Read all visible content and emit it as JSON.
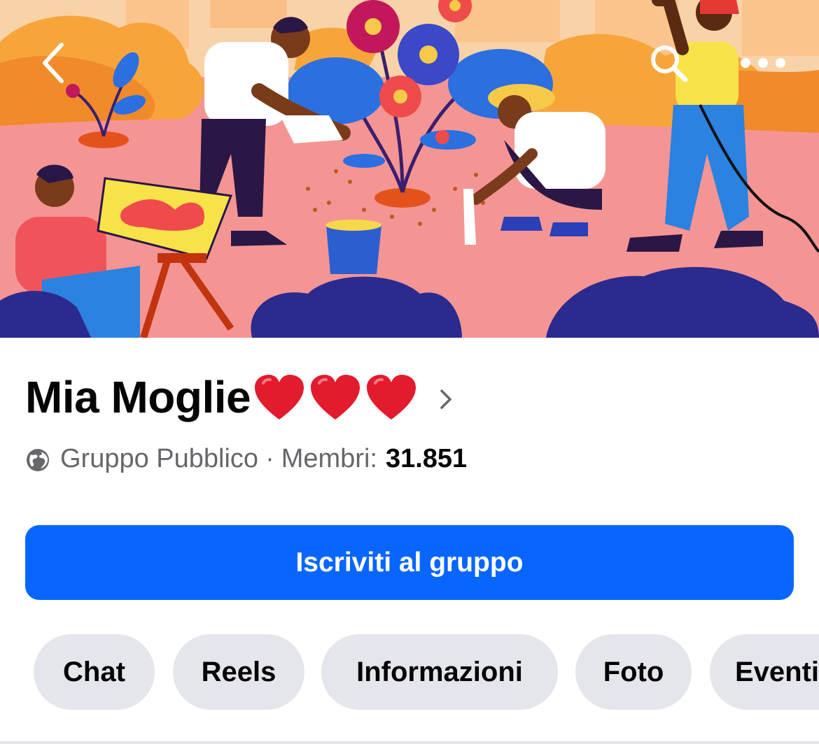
{
  "group": {
    "name": "Mia Moglie",
    "title_emoji": [
      "heart",
      "heart",
      "heart"
    ],
    "privacy": "Gruppo Pubblico",
    "separator": "·",
    "members_label": "Membri:",
    "members_count": "31.851"
  },
  "actions": {
    "join_label": "Iscriviti al gruppo"
  },
  "tabs": [
    {
      "label": "Chat"
    },
    {
      "label": "Reels"
    },
    {
      "label": "Informazioni"
    },
    {
      "label": "Foto"
    },
    {
      "label": "Eventi"
    }
  ],
  "icons": {
    "back": "chevron-left-icon",
    "search": "search-icon",
    "more": "more-dots-icon",
    "globe": "globe-icon",
    "title_chevron": "chevron-right-icon"
  },
  "colors": {
    "accent": "#0866ff",
    "chip": "#e4e6eb",
    "text_primary": "#050505",
    "text_secondary": "#65676b",
    "heart": "#e21b2d"
  }
}
